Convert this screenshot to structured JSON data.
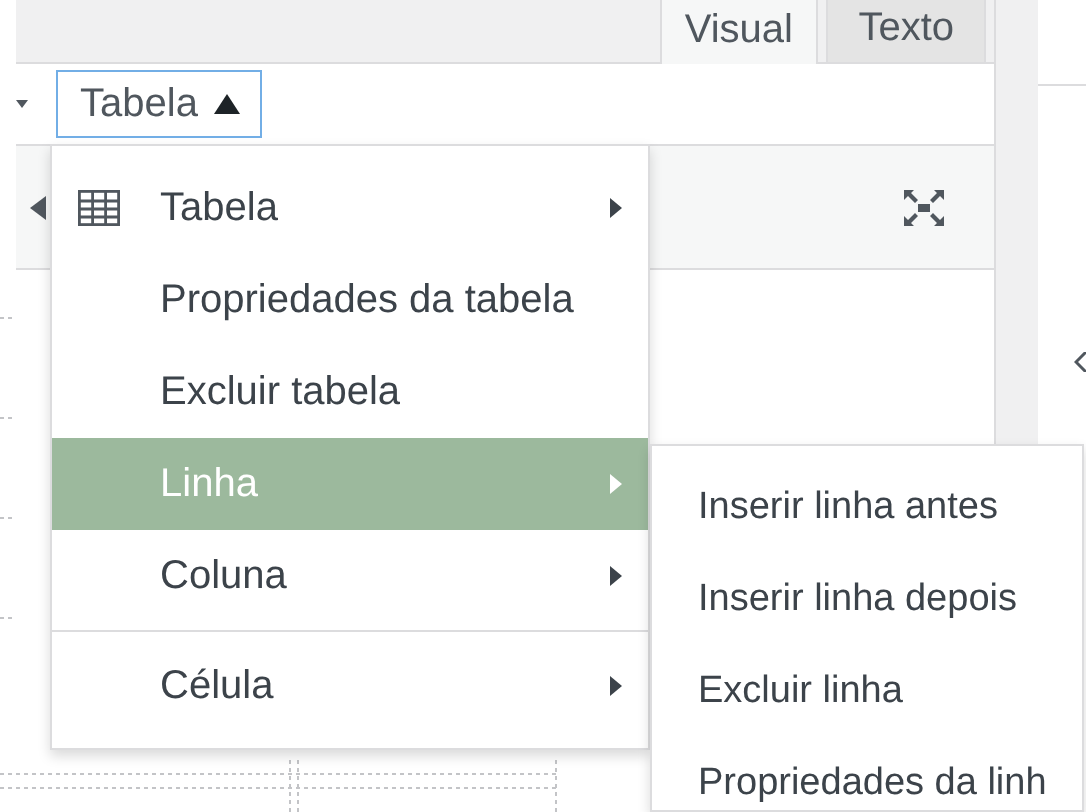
{
  "tabs": [
    {
      "label": "Visual",
      "selected": true
    },
    {
      "label": "Texto",
      "selected": false
    }
  ],
  "toolbar": {
    "table_button": {
      "label": "Tabela",
      "expanded": true
    }
  },
  "menu": {
    "items": [
      {
        "label": "Tabela",
        "kind": "table",
        "has_submenu": true,
        "selected": false,
        "separator_before": false
      },
      {
        "label": "Propriedades da tabela",
        "kind": "plain",
        "has_submenu": false,
        "selected": false,
        "separator_before": false
      },
      {
        "label": "Excluir tabela",
        "kind": "plain",
        "has_submenu": false,
        "selected": false,
        "separator_before": false
      },
      {
        "label": "Linha",
        "kind": "plain",
        "has_submenu": true,
        "selected": true,
        "separator_before": false
      },
      {
        "label": "Coluna",
        "kind": "plain",
        "has_submenu": true,
        "selected": false,
        "separator_before": false
      },
      {
        "label": "Célula",
        "kind": "plain",
        "has_submenu": true,
        "selected": false,
        "separator_before": true
      }
    ]
  },
  "submenu": {
    "items": [
      {
        "label": "Inserir linha antes",
        "selected": false
      },
      {
        "label": "Inserir linha depois",
        "selected": false
      },
      {
        "label": "Excluir linha",
        "selected": false
      },
      {
        "label": "Propriedades da linh",
        "selected": false
      }
    ]
  }
}
